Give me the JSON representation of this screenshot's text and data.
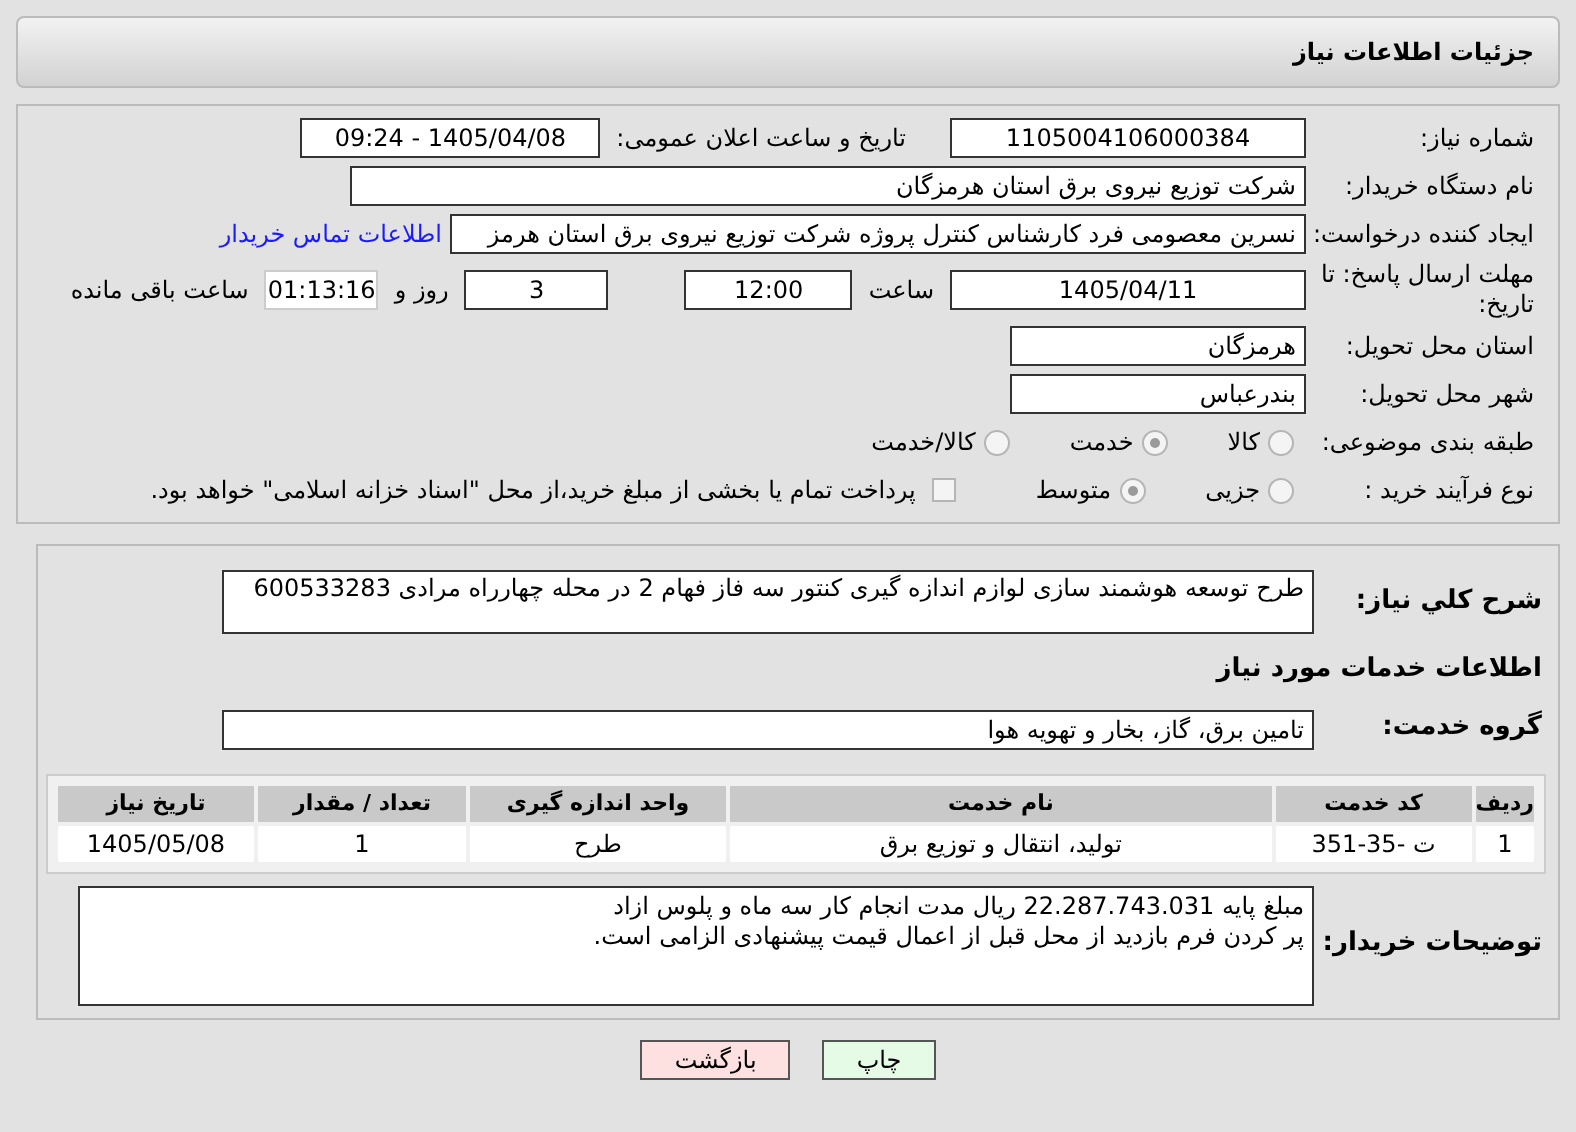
{
  "header": {
    "title": "جزئیات اطلاعات نیاز"
  },
  "need_number": {
    "label": "شماره نیاز:",
    "value": "1105004106000384"
  },
  "announce": {
    "label": "تاریخ و ساعت اعلان عمومی:",
    "value": "1405/04/08 - 09:24"
  },
  "buyer": {
    "label": "نام دستگاه خریدار:",
    "value": "شرکت توزیع نیروی برق استان هرمزگان"
  },
  "creator": {
    "label": "ایجاد کننده درخواست:",
    "value": "نسرین معصومی فرد کارشناس کنترل پروژه شرکت توزیع نیروی برق استان هرمز",
    "link": "اطلاعات تماس خریدار"
  },
  "deadline": {
    "label": "مهلت ارسال پاسخ: تا تاریخ:",
    "date": "1405/04/11",
    "time_label": "ساعت",
    "time": "12:00",
    "days": "3",
    "days_label": "روز و",
    "remaining": "01:13:16",
    "remaining_label": "ساعت باقی مانده"
  },
  "province": {
    "label": "استان محل تحویل:",
    "value": "هرمزگان"
  },
  "city": {
    "label": "شهر محل تحویل:",
    "value": "بندرعباس"
  },
  "category": {
    "label": "طبقه بندی موضوعی:",
    "options": [
      {
        "label": "کالا",
        "selected": false
      },
      {
        "label": "خدمت",
        "selected": true
      },
      {
        "label": "کالا/خدمت",
        "selected": false
      }
    ]
  },
  "process": {
    "label": "نوع فرآیند خرید :",
    "options": [
      {
        "label": "جزیی",
        "selected": false
      },
      {
        "label": "متوسط",
        "selected": true
      }
    ],
    "payment": {
      "label": "پرداخت تمام یا بخشی از مبلغ خرید،از محل \"اسناد خزانه اسلامی\" خواهد بود.",
      "checked": false
    }
  },
  "description": {
    "label": "شرح کلي نياز:",
    "value": "طرح توسعه هوشمند سازی لوازم اندازه گیری کنتور سه فاز فهام 2 در محله چهارراه مرادی 600533283"
  },
  "services_title": "اطلاعات خدمات مورد نیاز",
  "service_group": {
    "label": "گروه خدمت:",
    "value": "تامین برق، گاز، بخار و تهویه هوا"
  },
  "table": {
    "columns": [
      "ردیف",
      "کد خدمت",
      "نام خدمت",
      "واحد اندازه گیری",
      "تعداد / مقدار",
      "تاریخ نیاز"
    ],
    "rows": [
      [
        "1",
        "ت -35-351",
        "تولید، انتقال و توزیع برق",
        "طرح",
        "1",
        "1405/05/08"
      ]
    ]
  },
  "buyer_notes": {
    "label": "توضیحات خریدار:",
    "lines": [
      "مبلغ پایه 22.287.743.031 ریال مدت انجام کار سه ماه و پلوس ازاد",
      "پر کردن فرم بازدید از محل قبل از اعمال قیمت پیشنهادی الزامی است."
    ]
  },
  "buttons": [
    {
      "label": "چاپ",
      "kind": "print"
    },
    {
      "label": "بازگشت",
      "kind": "back"
    }
  ]
}
